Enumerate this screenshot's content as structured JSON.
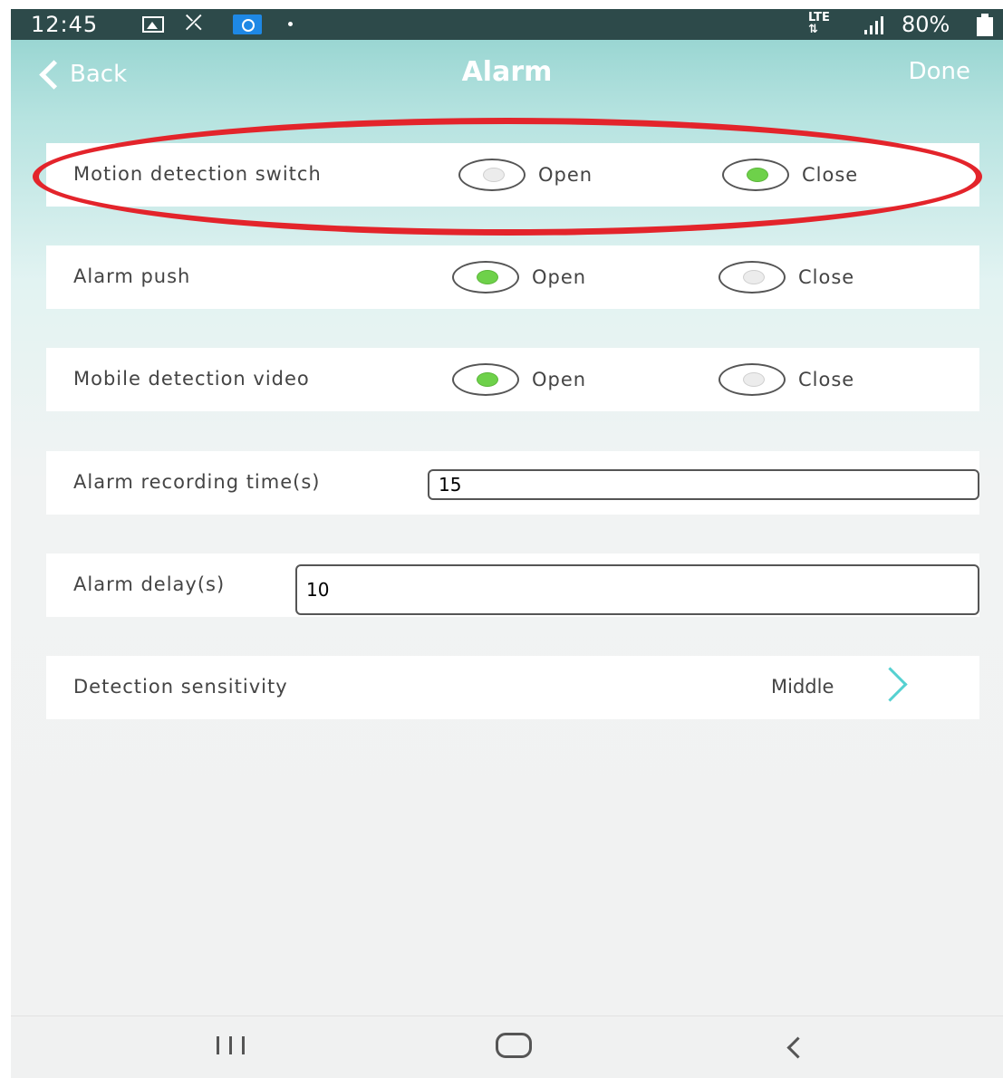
{
  "status_bar": {
    "time": "12:45",
    "network": "LTE",
    "battery": "80%",
    "icons": [
      "gallery-icon",
      "missed-call-icon",
      "app-notification-icon",
      "dot-icon",
      "signal-icon",
      "battery-icon"
    ]
  },
  "nav": {
    "back_label": "Back",
    "title": "Alarm",
    "done_label": "Done"
  },
  "settings": {
    "motion_detection": {
      "label": "Motion detection switch",
      "open": "Open",
      "close": "Close",
      "selected": "close"
    },
    "alarm_push": {
      "label": "Alarm push",
      "open": "Open",
      "close": "Close",
      "selected": "open"
    },
    "mobile_detection_video": {
      "label": "Mobile detection video",
      "open": "Open",
      "close": "Close",
      "selected": "open"
    },
    "alarm_recording_time": {
      "label": "Alarm recording time(s)",
      "value": "15"
    },
    "alarm_delay": {
      "label": "Alarm delay(s)",
      "value": "10"
    },
    "detection_sensitivity": {
      "label": "Detection sensitivity",
      "value": "Middle"
    }
  },
  "colors": {
    "accent": "#55d1d1",
    "radio_on": "#6ed14a",
    "highlight_ring": "#e3242b",
    "status_bar": "#2d4a4a"
  }
}
